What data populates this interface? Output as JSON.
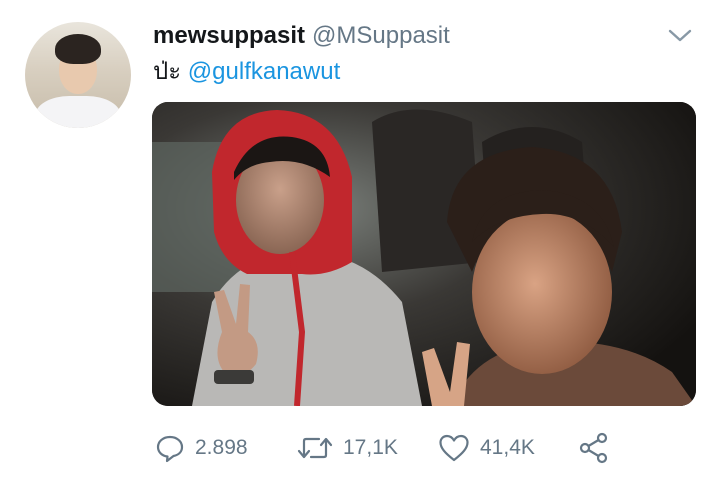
{
  "tweet": {
    "display_name": "mewsuppasit",
    "handle": "@MSuppasit",
    "text_prefix": "ป่ะ",
    "mention": "@gulfkanawut"
  },
  "actions": {
    "replies": "2.898",
    "retweets": "17,1K",
    "likes": "41,4K"
  },
  "icons": [
    "chevron-down-icon",
    "reply-icon",
    "retweet-icon",
    "like-icon",
    "share-icon"
  ],
  "colors": {
    "text": "#14171a",
    "secondary": "#657786",
    "link": "#1b95e0"
  }
}
